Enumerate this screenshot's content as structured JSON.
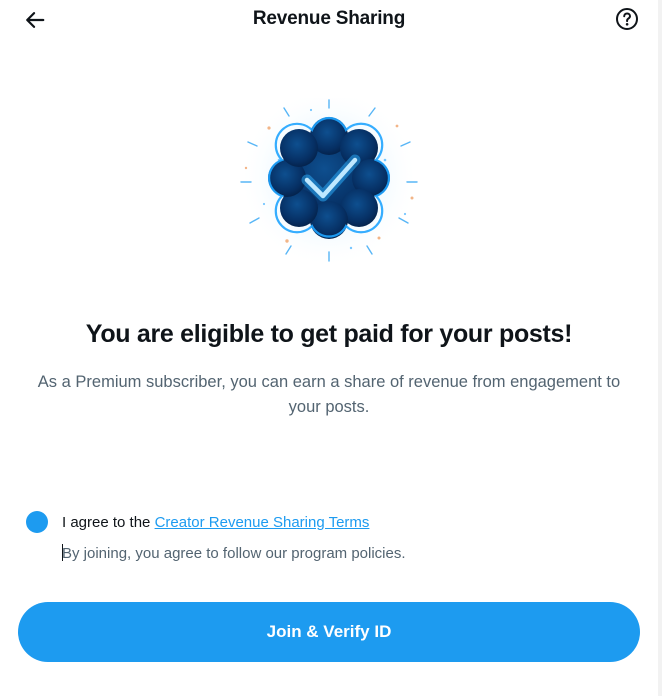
{
  "header": {
    "title": "Revenue Sharing",
    "back_icon": "arrow-left-icon",
    "help_icon": "question-circle-icon"
  },
  "hero": {
    "icon": "verified-badge-icon",
    "headline": "You are eligible to get paid for your posts!",
    "description": "As a Premium subscriber, you can earn a share of revenue from engagement to your posts."
  },
  "agreement": {
    "checked": true,
    "prefix": "I agree to the ",
    "link_text": "Creator Revenue Sharing Terms",
    "note": "By joining, you agree to follow our program policies."
  },
  "cta": {
    "label": "Join & Verify ID"
  },
  "colors": {
    "accent": "#1d9bf0",
    "text_primary": "#0f1419",
    "text_secondary": "#536471"
  }
}
